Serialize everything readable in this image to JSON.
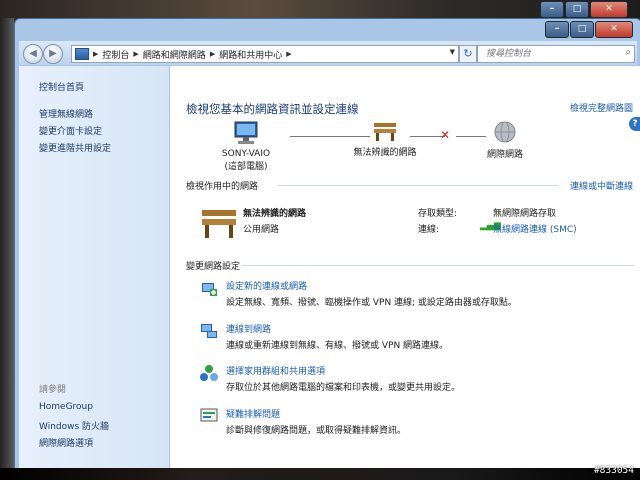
{
  "window": {
    "minimize_glyph": "–",
    "maximize_glyph": "□",
    "close_glyph": "✕"
  },
  "address": {
    "crumbs": [
      "控制台",
      "網路和網際網路",
      "網路和共用中心"
    ],
    "search_placeholder": "搜尋控制台"
  },
  "sidebar": {
    "home": "控制台首頁",
    "items": [
      "管理無線網路",
      "變更介面卡設定",
      "變更進階共用設定"
    ],
    "see_also_title": "請參閱",
    "see_also": [
      "HomeGroup",
      "Windows 防火牆",
      "網際網路選項"
    ]
  },
  "main": {
    "title": "檢視您基本的網路資訊並設定連線",
    "full_map_link": "檢視完整網路圖",
    "map": {
      "computer_name": "SONY-VAIO",
      "computer_sub": "(這部電腦)",
      "network_name": "無法辨識的網路",
      "internet": "網際網路"
    },
    "active": {
      "heading": "檢視作用中的網路",
      "connect_link": "連線或中斷連線",
      "network_name": "無法辨識的網路",
      "network_type": "公用網路",
      "access_type_label": "存取類型:",
      "access_type_value": "無網際網路存取",
      "connections_label": "連線:",
      "connections_value": "無線網路連線 (SMC)"
    },
    "change": {
      "heading": "變更網路設定",
      "tasks": [
        {
          "link": "設定新的連線或網路",
          "desc": "設定無線、寬頻、撥號、臨機操作或 VPN 連線; 或設定路由器或存取點。"
        },
        {
          "link": "連線到網路",
          "desc": "連線或重新連線到無線、有線、撥號或 VPN 網路連線。"
        },
        {
          "link": "選擇家用群組和共用選項",
          "desc": "存取位於其他網路電腦的檔案和印表機，或變更共用設定。"
        },
        {
          "link": "疑難排解問題",
          "desc": "診斷與修復網路問題，或取得疑難排解資訊。"
        }
      ]
    }
  },
  "watermark": "#833054"
}
